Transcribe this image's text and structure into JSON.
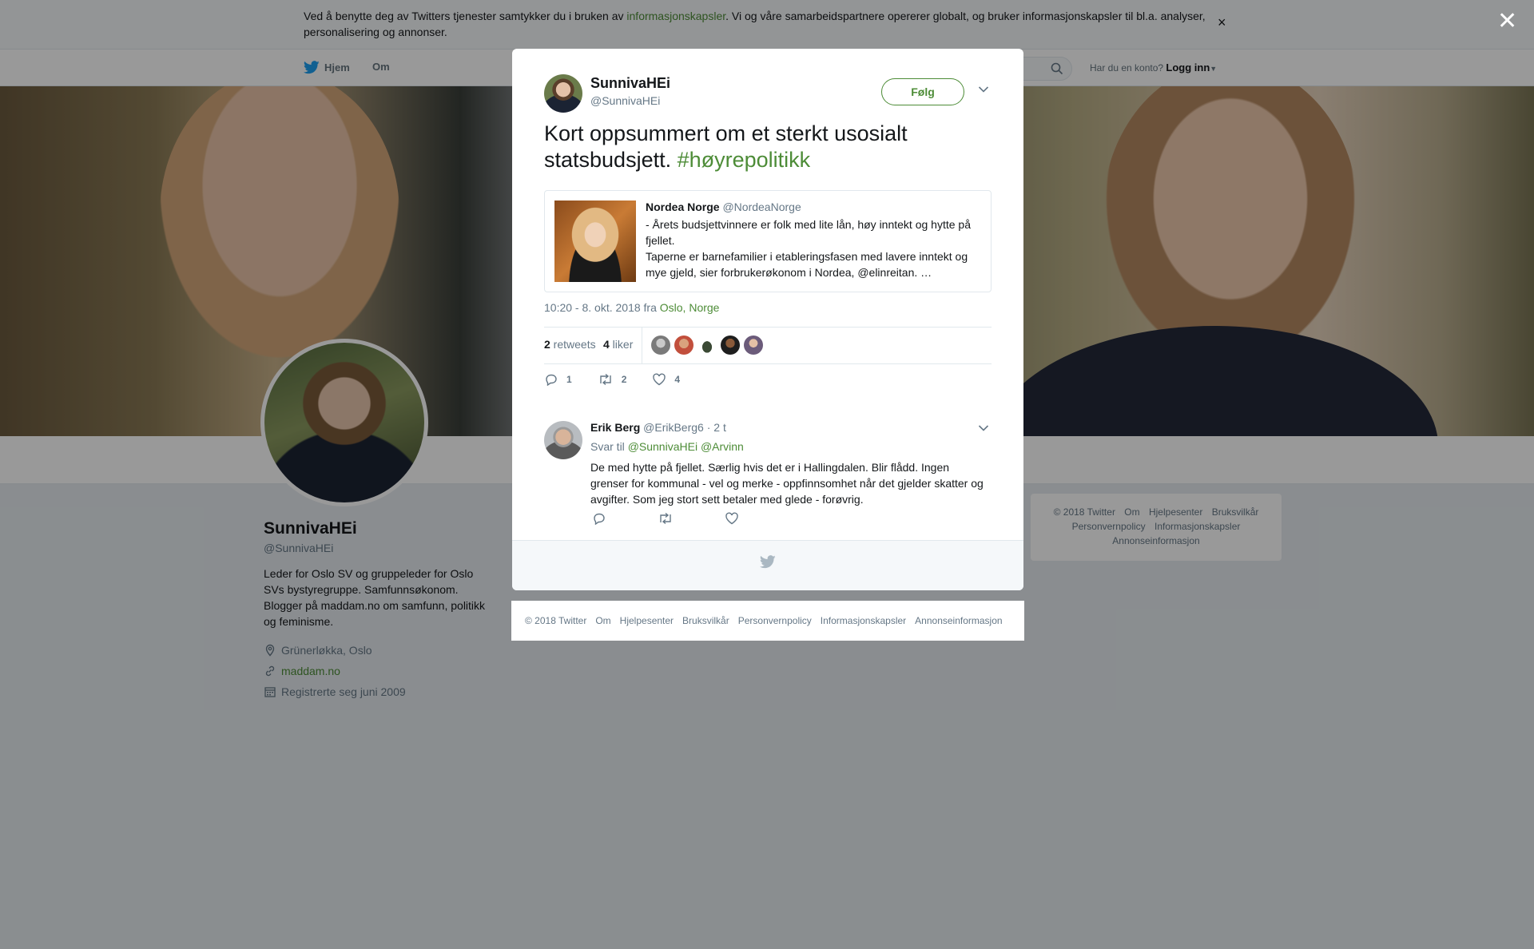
{
  "cookie": {
    "text_before": "Ved å benytte deg av Twitters tjenester samtykker du i bruken av ",
    "link": "informasjonskapsler",
    "text_after": ". Vi og våre samarbeidspartnere opererer globalt, og bruker informasjonskapsler til bl.a. analyser, personalisering og annonser.",
    "close": "×"
  },
  "nav": {
    "home": "Hjem",
    "about": "Om",
    "login_prompt": "Har du en konto?",
    "login": "Logg inn"
  },
  "profile": {
    "name": "SunnivaHEi",
    "handle": "@SunnivaHEi",
    "bio": "Leder for Oslo SV og gruppeleder for Oslo SVs bystyregruppe. Samfunnsøkonom. Blogger på maddam.no om samfunn, politikk og feminisme.",
    "location": "Grünerløkka, Oslo",
    "website": "maddam.no",
    "joined": "Registrerte seg juni 2009"
  },
  "right_footer": [
    "© 2018 Twitter",
    "Om",
    "Hjelpesenter",
    "Bruksvilkår",
    "Personvernpolicy",
    "Informasjonskapsler",
    "Annonseinformasjon"
  ],
  "modal": {
    "close": "✕",
    "author_name": "SunnivaHEi",
    "author_handle": "@SunnivaHEi",
    "follow": "Følg",
    "text": "Kort oppsummert om et sterkt usosialt statsbudsjett.",
    "hashtag": "#høyrepolitikk",
    "quote": {
      "name": "Nordea Norge",
      "handle": "@NordeaNorge",
      "line1": "- Årets budsjettvinnere er folk med lite lån, høy inntekt og hytte på fjellet.",
      "line2": "Taperne er barnefamilier i etableringsfasen med lavere inntekt og mye gjeld, sier forbrukerøkonom i Nordea, @elinreitan. …"
    },
    "time": "10:20 - 8. okt. 2018 fra ",
    "place": "Oslo, Norge",
    "retweets_count": "2",
    "retweets_label": " retweets",
    "likes_count": "4",
    "likes_label": " liker",
    "action_reply_count": "1",
    "action_retweet_count": "2",
    "action_like_count": "4",
    "reply": {
      "name": "Erik Berg",
      "handle": "@ErikBerg6",
      "time": "· 2 t",
      "to_label": "Svar til ",
      "to_users": "@SunnivaHEi @Arvinn",
      "text": "De med hytte på fjellet. Særlig hvis det er i Hallingdalen. Blir flådd. Ingen grenser for kommunal - vel og merke - oppfinnsomhet når det gjelder skatter og avgifter. Som jeg stort sett betaler med glede - forøvrig."
    }
  },
  "modal_footer": [
    "© 2018 Twitter",
    "Om",
    "Hjelpesenter",
    "Bruksvilkår",
    "Personvernpolicy",
    "Informasjonskapsler",
    "Annonseinformasjon"
  ],
  "colors": {
    "accent": "#4d8c37",
    "twitter_blue": "#1da1f2",
    "muted": "#657786"
  },
  "icons": [
    "twitter-bird-icon",
    "search-icon",
    "location-icon",
    "link-icon",
    "calendar-icon",
    "reply-icon",
    "retweet-icon",
    "like-icon",
    "chevron-down-icon",
    "close-icon"
  ]
}
